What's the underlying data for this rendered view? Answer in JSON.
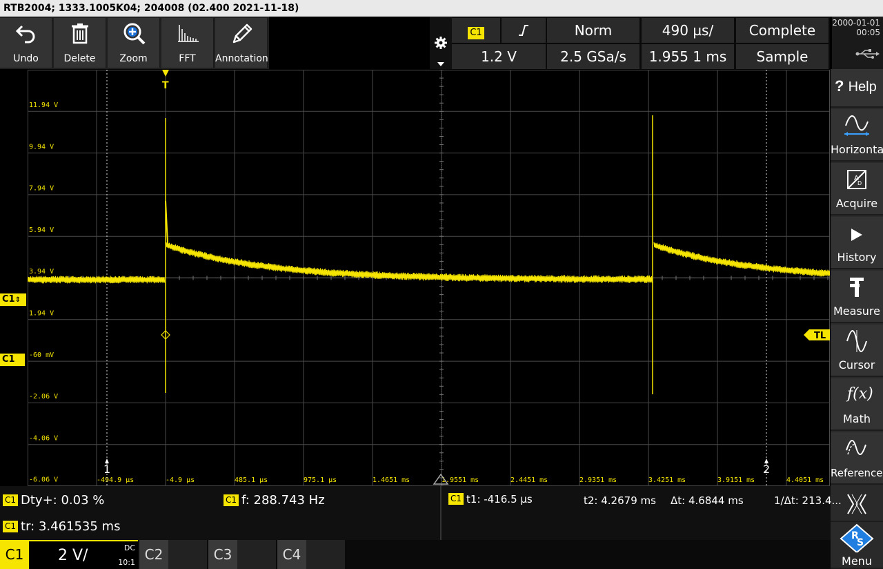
{
  "title_bar": "RTB2004; 1333.1005K04; 204008 (02.400 2021-11-18)",
  "toolbar": [
    {
      "label": "Undo",
      "icon": "undo-icon"
    },
    {
      "label": "Delete",
      "icon": "trash-icon"
    },
    {
      "label": "Zoom",
      "icon": "zoom-icon"
    },
    {
      "label": "FFT",
      "icon": "fft-icon"
    },
    {
      "label": "Annotation",
      "icon": "pencil-icon"
    }
  ],
  "info": {
    "channel": "C1",
    "trigger_edge_icon": "rising-edge-icon",
    "trigger_mode": "Norm",
    "time_scale": "490 µs/",
    "acq_state": "Complete",
    "trigger_level": "1.2 V",
    "sample_rate": "2.5 GSa/s",
    "time_position": "1.955 1 ms",
    "acq_mode": "Sample"
  },
  "datetime": {
    "date": "2000-01-01",
    "time": "00:05"
  },
  "sidebar": [
    {
      "label": "Help",
      "icon": "help-icon"
    },
    {
      "label": "Horizontal",
      "icon": "horizontal-icon"
    },
    {
      "label": "Acquire",
      "icon": "acquire-icon"
    },
    {
      "label": "History",
      "icon": "play-icon"
    },
    {
      "label": "Measure",
      "icon": "measure-icon"
    },
    {
      "label": "Cursor",
      "icon": "cursor-icon"
    },
    {
      "label": "Math",
      "icon": "math-icon"
    },
    {
      "label": "References",
      "icon": "references-icon"
    },
    {
      "label": "Menu",
      "icon": "rs-logo-icon"
    }
  ],
  "graph": {
    "y_labels": [
      "11.94 V",
      "9.94 V",
      "7.94 V",
      "5.94 V",
      "3.94 V",
      "1.94 V",
      "-60 mV",
      "-2.06 V",
      "-4.06 V",
      "-6.06 V"
    ],
    "x_labels": [
      "-494.9 µs",
      "-4.9 µs",
      "485.1 µs",
      "975.1 µs",
      "1.4651 ms",
      "1.9551 ms",
      "2.4451 ms",
      "2.9351 ms",
      "3.4251 ms",
      "3.9151 ms",
      "4.4051 ms"
    ],
    "trigger_marker": "T",
    "trigger_level_marker": "TL",
    "cursor1_label": "1",
    "cursor2_label": "2",
    "trace_color": "#f5e500",
    "grid_color": "#4a4a4a"
  },
  "left_markers": {
    "ch_offset": "C1",
    "ch_ground": "C1"
  },
  "measurements": {
    "dty_badge": "C1",
    "dty": "Dty+: 0.03 %",
    "freq_badge": "C1",
    "freq": "f: 288.743 Hz",
    "tr_badge": "C1",
    "tr": "tr: 3.461535 ms",
    "cursor_badge": "C1",
    "t1": "t1: -416.5 µs",
    "t2": "t2: 4.2679 ms",
    "dt": "Δt: 4.6844 ms",
    "inv_dt": "1/Δt: 213.4..."
  },
  "channels": {
    "c1_label": "C1",
    "c1_scale": "2 V/",
    "c1_coupling": "DC",
    "c1_probe": "10:1",
    "c2_label": "C2",
    "c3_label": "C3",
    "c4_label": "C4"
  }
}
